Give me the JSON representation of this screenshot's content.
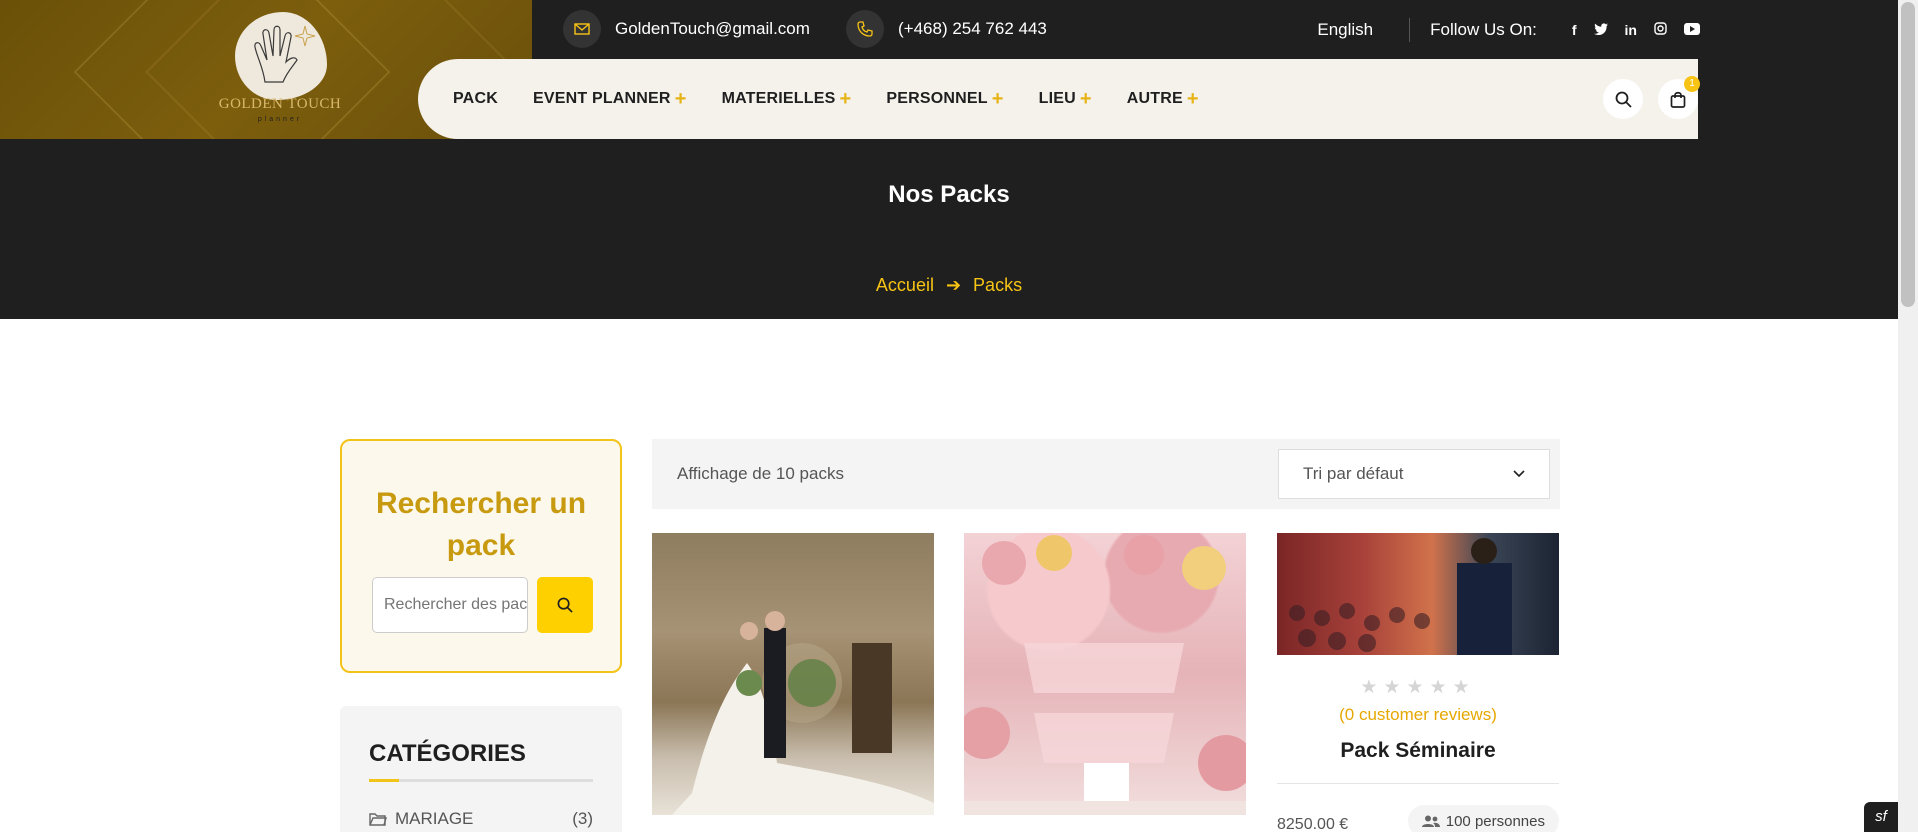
{
  "logo": {
    "name": "GOLDEN TOUCH",
    "sub": "planner"
  },
  "topbar": {
    "email": "GoldenTouch@gmail.com",
    "phone": "(+468) 254 762 443",
    "language": "English",
    "follow_label": "Follow Us On:",
    "social_icons": [
      "facebook-icon",
      "twitter-icon",
      "linkedin-icon",
      "instagram-icon",
      "youtube-icon"
    ]
  },
  "nav": {
    "items": [
      {
        "label": "PACK",
        "has_submenu": false
      },
      {
        "label": "EVENT PLANNER",
        "has_submenu": true
      },
      {
        "label": "MATERIELLES",
        "has_submenu": true
      },
      {
        "label": "PERSONNEL",
        "has_submenu": true
      },
      {
        "label": "LIEU",
        "has_submenu": true
      },
      {
        "label": "AUTRE",
        "has_submenu": true
      }
    ],
    "plus_symbol": "+",
    "cart_count": "1"
  },
  "banner": {
    "title": "Nos Packs",
    "breadcrumb": [
      "Accueil",
      "Packs"
    ],
    "arrow": "➔"
  },
  "sidebar": {
    "search_title": "Rechercher un pack",
    "search_placeholder": "Rechercher des packs",
    "categories_title": "CATÉGORIES",
    "categories": [
      {
        "name": "MARIAGE",
        "count": "(3)"
      }
    ]
  },
  "listing": {
    "count_text": "Affichage de 10 packs",
    "sort_value": "Tri par défaut"
  },
  "products": [
    {
      "image": "wedding-photo"
    },
    {
      "image": "birthday-photo"
    },
    {
      "image": "seminar-photo",
      "rating": 0,
      "stars": "★★★★★",
      "reviews": "(0 customer reviews)",
      "title": "Pack Séminaire",
      "price": "8250.00 €",
      "capacity": "100 personnes"
    }
  ],
  "colors": {
    "accent": "#f7c315",
    "dark": "#1f1f1f",
    "gold_title": "#c79a10"
  }
}
